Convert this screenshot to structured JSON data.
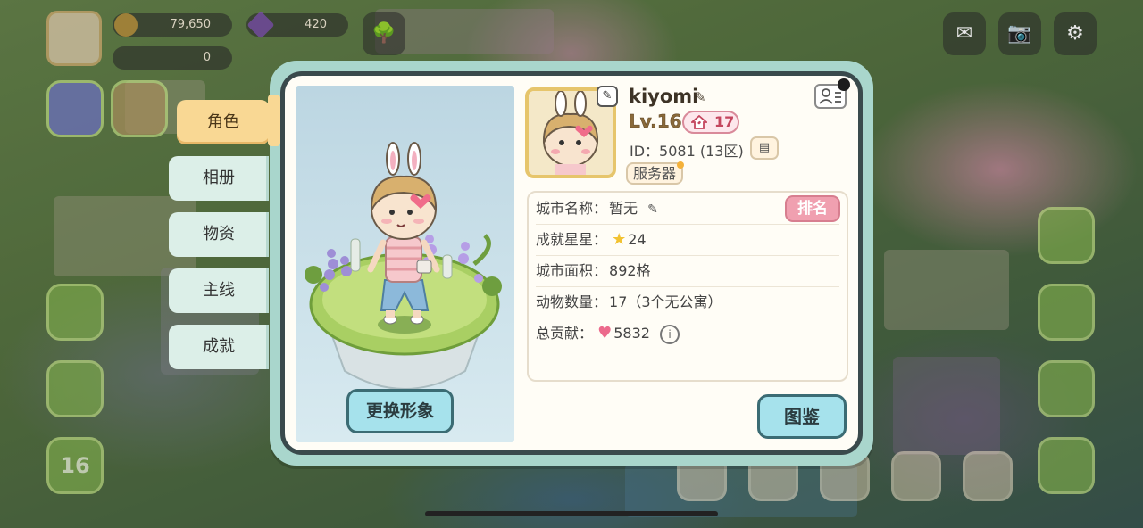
{
  "hud": {
    "coins": "79,650",
    "gems": "420",
    "energy": "0",
    "level_badge": "16"
  },
  "tabs": [
    {
      "label": "角色",
      "active": true
    },
    {
      "label": "相册",
      "active": false
    },
    {
      "label": "物资",
      "active": false
    },
    {
      "label": "主线",
      "active": false
    },
    {
      "label": "成就",
      "active": false
    }
  ],
  "character": {
    "change_button_label": "更换形象"
  },
  "profile": {
    "name": "kiyomi",
    "level": "Lv.16",
    "home_level": "17",
    "id_text": "ID：5081 (13区)",
    "server_label": "服务器"
  },
  "stats": {
    "city_name_label": "城市名称：",
    "city_name_value": "暂无",
    "rank_label": "排名",
    "stars_label": "成就星星：",
    "stars_value": "24",
    "area_label": "城市面积：",
    "area_value": "892格",
    "animals_label": "动物数量：",
    "animals_value": "17（3个无公寓）",
    "contribution_label": "总贡献：",
    "contribution_value": "5832"
  },
  "atlas_button_label": "图鉴",
  "colors": {
    "panel_frame": "#a9d6cc",
    "active_tab": "#f9d894",
    "primary_button": "#a6e2ec",
    "rank_button": "#f0a0b0"
  }
}
